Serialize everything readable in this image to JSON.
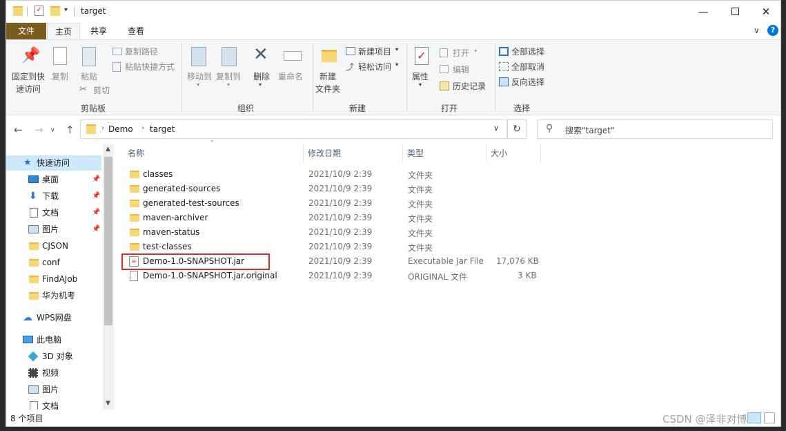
{
  "title": {
    "folder_name": "target"
  },
  "ribbon": {
    "tabs": [
      "文件",
      "主页",
      "共享",
      "查看"
    ],
    "clipboard": {
      "group": "剪贴板",
      "pin_line1": "固定到快",
      "pin_line2": "速访问",
      "copy": "复制",
      "paste": "粘贴",
      "copy_path": "复制路径",
      "paste_shortcut": "粘贴快捷方式",
      "cut": "剪切"
    },
    "organize": {
      "group": "组织",
      "move_to": "移动到",
      "copy_to": "复制到",
      "delete": "删除",
      "rename": "重命名"
    },
    "new": {
      "group": "新建",
      "new_item": "新建项目",
      "easy_access": "轻松访问",
      "new_folder_line1": "新建",
      "new_folder_line2": "文件夹"
    },
    "open": {
      "group": "打开",
      "properties": "属性",
      "open": "打开",
      "edit": "编辑",
      "history": "历史记录"
    },
    "select": {
      "group": "选择",
      "select_all": "全部选择",
      "select_none": "全部取消",
      "invert": "反向选择"
    }
  },
  "address": {
    "breadcrumb": [
      "Demo",
      "target"
    ],
    "search_placeholder": "搜索\"target\""
  },
  "nav": {
    "quick_access": "快速访问",
    "items": [
      {
        "label": "桌面",
        "pinned": true
      },
      {
        "label": "下载",
        "pinned": true
      },
      {
        "label": "文档",
        "pinned": true
      },
      {
        "label": "图片",
        "pinned": true
      },
      {
        "label": "CJSON",
        "pinned": false
      },
      {
        "label": "conf",
        "pinned": false
      },
      {
        "label": "FindAJob",
        "pinned": false
      },
      {
        "label": "华为机考",
        "pinned": false
      }
    ],
    "wps": "WPS网盘",
    "this_pc": "此电脑",
    "pc_items": [
      "3D 对象",
      "视频",
      "图片",
      "文档"
    ]
  },
  "columns": {
    "name": "名称",
    "modified": "修改日期",
    "type": "类型",
    "size": "大小"
  },
  "files": [
    {
      "name": "classes",
      "date": "2021/10/9 2:39",
      "type": "文件夹",
      "size": "",
      "kind": "folder"
    },
    {
      "name": "generated-sources",
      "date": "2021/10/9 2:39",
      "type": "文件夹",
      "size": "",
      "kind": "folder"
    },
    {
      "name": "generated-test-sources",
      "date": "2021/10/9 2:39",
      "type": "文件夹",
      "size": "",
      "kind": "folder"
    },
    {
      "name": "maven-archiver",
      "date": "2021/10/9 2:39",
      "type": "文件夹",
      "size": "",
      "kind": "folder"
    },
    {
      "name": "maven-status",
      "date": "2021/10/9 2:39",
      "type": "文件夹",
      "size": "",
      "kind": "folder"
    },
    {
      "name": "test-classes",
      "date": "2021/10/9 2:39",
      "type": "文件夹",
      "size": "",
      "kind": "folder"
    },
    {
      "name": "Demo-1.0-SNAPSHOT.jar",
      "date": "2021/10/9 2:39",
      "type": "Executable Jar File",
      "size": "17,076 KB",
      "kind": "jar"
    },
    {
      "name": "Demo-1.0-SNAPSHOT.jar.original",
      "date": "2021/10/9 2:39",
      "type": "ORIGINAL 文件",
      "size": "3 KB",
      "kind": "file"
    }
  ],
  "status": {
    "item_count": "8 个项目"
  },
  "watermark": "CSDN @泽非对博",
  "colors": {
    "accent": "#0078d7",
    "file_tab": "#7a5c1e",
    "selection": "#cce8ff",
    "highlight_box": "#e0292b"
  }
}
